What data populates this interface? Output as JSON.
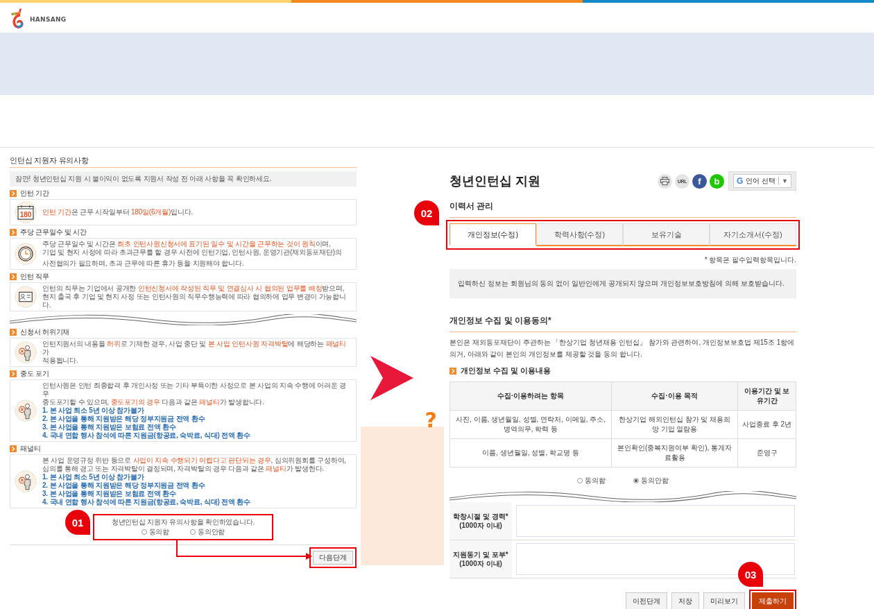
{
  "top_bar": {
    "logo_text": "HANSANG"
  },
  "notice": {
    "title": "인턴십 지원자 유의사항",
    "intro": "잠깐! 청년인턴십 지원 시 불이익이 없도록 지원서 작성 전 아래 사항을 꼭 확인하세요.",
    "sections": [
      {
        "heading": "인턴 기간",
        "icon": {
          "kind": "calendar",
          "text": "180"
        },
        "break_after": false,
        "paragraphs": [
          [
            "**인턴 기간**은 근무 시작일부터 **180일(6개월)**입니다."
          ]
        ]
      },
      {
        "heading": "주당 근무일수 및 시간",
        "icon": {
          "kind": "clock"
        },
        "break_after": false,
        "paragraphs": [
          [
            "주당 근무일수 및 시간은 **최초 인턴사원신청서에 표기된 일수 및 시간을 근무하는 것이 원칙**이며,",
            "기업 및 현지 사정에 따라 초과근무를 할 경우 사전에 인턴기업, 인턴사원, 운영기관(재외동포재단)의"
          ],
          [
            "사전협의가 필요하며, 초과 근무에 따른 휴가 등을 지원해야 합니다."
          ]
        ]
      },
      {
        "heading": "인턴 직무",
        "icon": {
          "kind": "profile_card"
        },
        "break_after": true,
        "paragraphs": [
          [
            "인턴의 직무는 기업에서 공개한 **인턴신청서에 작성된 직무 및 연결심사 시 협의된 업무를 배정**받으며,",
            "현지 출국 후 기업 및 현지 사정 또는 인턴사원의 직무수행능력에 따라 협의하에 업무 변경이 가능합니다."
          ]
        ]
      },
      {
        "heading": "신청서 허위기재",
        "icon": {
          "kind": "person_x"
        },
        "break_after": false,
        "paragraphs": [
          [
            "인턴지원서의 내용을 **허위**로 기재한 경우, 사업 중단 및 **본 사업 인턴사원 자격박탈**에 해당하는 **패널티**가",
            "적용됩니다."
          ]
        ]
      },
      {
        "heading": "중도 포기",
        "icon": {
          "kind": "person_x"
        },
        "break_after": false,
        "paragraphs": [
          [
            "인턴사원은 인턴 최종합격 후 개인사정 또는 기타 부득이한 사정으로 본 사업의 지속 수행에 어려운 경우",
            "중도포기할 수 있으며, **중도포기의 경우** 다음과 같은 **패널티**가 발생합니다."
          ]
        ],
        "list": [
          "1. 본 사업 최소 5년 이상 참가불가",
          "2. 본 사업을 통해 지원받은 해당 정부지원금 전액 환수",
          "3. 본 사업을 통해 지원받은 보험료 전액 환수",
          "4. 국내 연합 행사 참석에 따른 지원금(항공료, 숙박료, 식대) 전액 환수"
        ]
      },
      {
        "heading": "패널티",
        "icon": {
          "kind": "person_x"
        },
        "break_after": false,
        "paragraphs": [
          [
            "본 사업 운영규정 위반 등으로 **사업이 지속 수행되기 어렵다고 판단되는 경우**, 심의위원회를 구성하여,",
            "심의를 통해 경고 또는 자격박탈이 결정되며, 자격박탈의 경우 다음과 같은 **패널티**가 발생한다."
          ]
        ],
        "list": [
          "1. 본 사업 최소 5년 이상 참가불가",
          "2. 본 사업을 통해 지원받은 해당 정부지원금 전액 환수",
          "3. 본 사업을 통해 지원받은 보험료 전액 환수",
          "4. 국내 연합 행사 참석에 따른 지원금(항공료, 숙박료, 식대) 전액 환수"
        ]
      }
    ],
    "confirm": {
      "text": "청년인턴십 지원자 유의사항을 확인하였습니다.",
      "options": [
        {
          "label": "동의함",
          "selected": false
        },
        {
          "label": "동의안함",
          "selected": false
        }
      ]
    },
    "next_button": "다음단계"
  },
  "middle": {
    "question_mark": "?"
  },
  "application": {
    "title": "청년인턴십 지원",
    "share": [
      {
        "kind": "print"
      },
      {
        "kind": "url",
        "text": "URL"
      },
      {
        "kind": "facebook",
        "text": "f"
      },
      {
        "kind": "band",
        "text": "b"
      }
    ],
    "language_select": {
      "logo": "G",
      "label": "언어 선택",
      "caret": "▼"
    },
    "section_title": "이력서 관리",
    "tabs": [
      {
        "label": "개인정보(수정)",
        "selected": true
      },
      {
        "label": "학력사항(수정)",
        "selected": false
      },
      {
        "label": "보유기술",
        "selected": false
      },
      {
        "label": "자기소개서(수정)",
        "selected": false
      }
    ],
    "required_note": "* 항목은 필수입력항목입니다.",
    "info": "입력하신 정보는 회원님의 동의 없이 일반인에게 공개되지 않으며 개인정보보호방침에 의해 보호받습니다.",
    "consent": {
      "title": "개인정보 수집 및 이용동의*",
      "text": "본인은 재외동포재단이 주관하는 「한상기업 청년채용 인턴십」 참가와 관련하여, 개인정보보호법 제15조 1항에 의거, 아래와 같이 본인의 개인정보를 제공할 것을 동의 합니다.",
      "subheading": "개인정보 수집 및 이용내용",
      "table": {
        "columns": [
          "수집·이용하려는 항목",
          "수집·이용 목적",
          "이용기간 및 보유기간"
        ],
        "rows": [
          [
            "사진, 이름, 생년월일, 성별, 연락처, 이메일, 주소, 병역의무, 학력 등",
            "한상기업 해외인턴십 참가 및 채용희망 기업 열람용",
            "사업종료 후 2년"
          ],
          [
            "이름, 생년월일, 성별, 학교명 등",
            "본인확인(중복지원여부 확인), 통계자료활용",
            "준영구"
          ]
        ]
      },
      "options": [
        {
          "label": "동의함",
          "selected": false
        },
        {
          "label": "동의안함",
          "selected": true
        }
      ]
    },
    "fields": [
      {
        "label": "학창시절 및 경력*",
        "hint": "(1000자 이내)"
      },
      {
        "label": "지원동기 및 포부*",
        "hint": "(1000자 이내)"
      }
    ],
    "buttons": [
      {
        "label": "이전단계",
        "kind": "default"
      },
      {
        "label": "저장",
        "kind": "default"
      },
      {
        "label": "미리보기",
        "kind": "default"
      },
      {
        "label": "제출하기",
        "kind": "primary"
      }
    ]
  },
  "callouts": [
    {
      "text": "01"
    },
    {
      "text": "02"
    },
    {
      "text": "03"
    }
  ]
}
